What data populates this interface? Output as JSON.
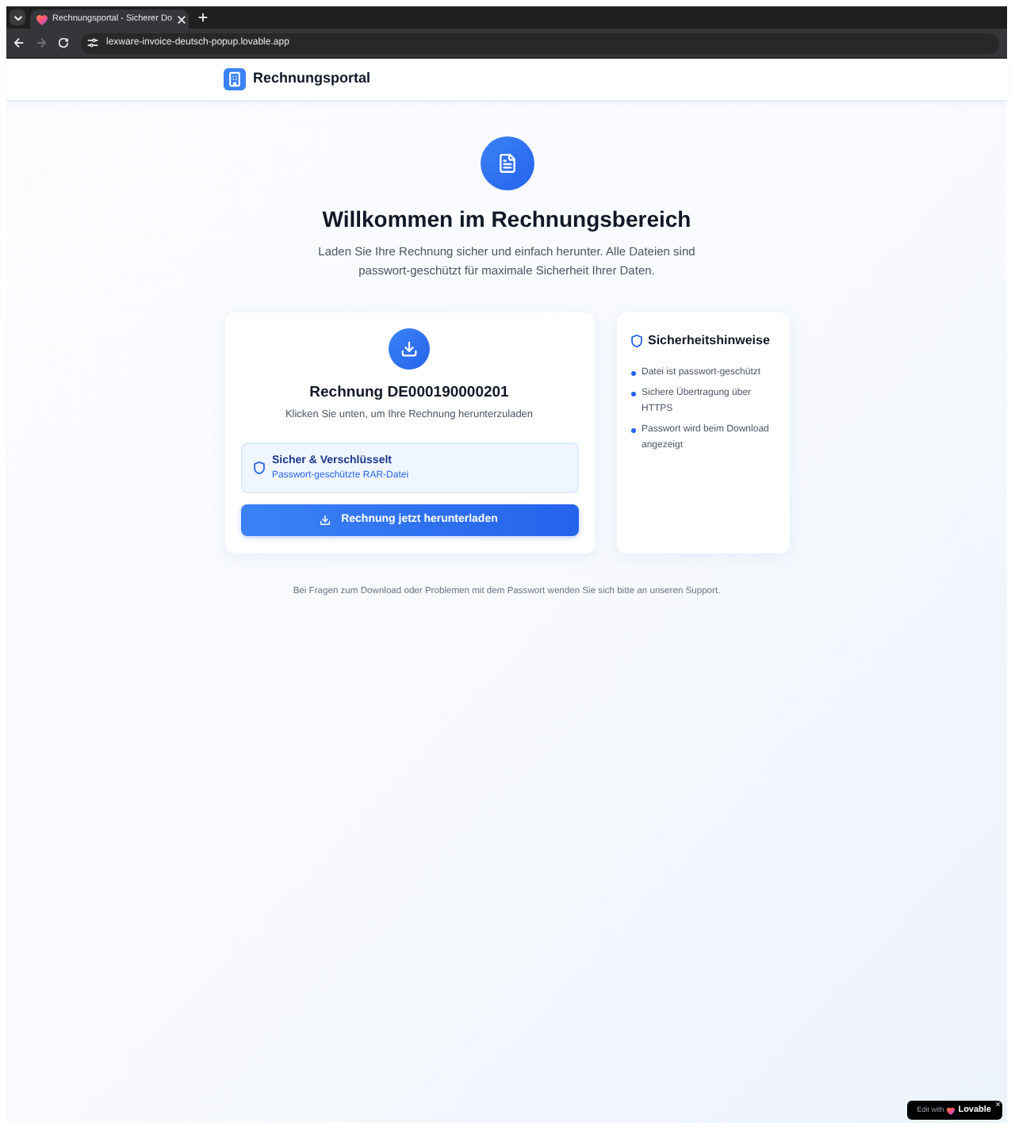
{
  "browser": {
    "tabs": [
      {
        "title": "Rechnungsportal - Sicherer Do",
        "selected": true
      }
    ],
    "forward_disabled": true,
    "url": "lexware-invoice-deutsch-popup.lovable.app"
  },
  "header": {
    "brand": "Rechnungsportal"
  },
  "hero": {
    "title": "Willkommen im Rechnungsbereich",
    "subtitle": "Laden Sie Ihre Rechnung sicher und einfach herunter. Alle Dateien sind passwort-geschützt für maximale Sicherheit Ihrer Daten."
  },
  "download_card": {
    "title": "Rechnung DE000190000201",
    "subtitle": "Klicken Sie unten, um Ihre Rechnung herunterzuladen",
    "notice": {
      "title": "Sicher & Verschlüsselt",
      "detail": "Passwort-geschützte RAR-Datei"
    },
    "button": "Rechnung jetzt herunterladen"
  },
  "security_card": {
    "title": "Sicherheitshinweise",
    "items": [
      "Datei ist passwort-geschützt",
      "Sichere Übertragung über HTTPS",
      "Passwort wird beim Download angezeigt"
    ]
  },
  "footer_note": "Bei Fragen zum Download oder Problemen mit dem Passwort wenden Sie sich bitte an unseren Support.",
  "badge": {
    "label": "Edit with",
    "brand": "Lovable"
  }
}
